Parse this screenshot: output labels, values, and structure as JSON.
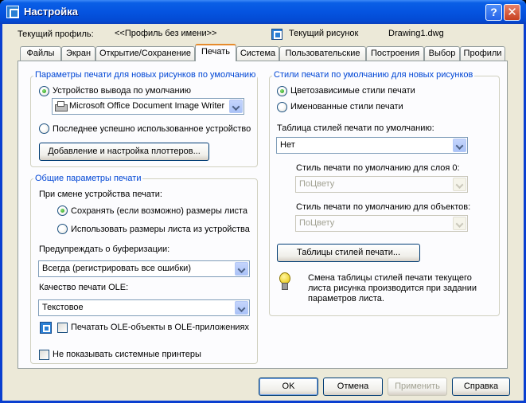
{
  "window": {
    "title": "Настройка",
    "help_glyph": "?",
    "close_glyph": "✕"
  },
  "header": {
    "profile_label": "Текущий профиль:",
    "profile_value": "<<Профиль без имени>>",
    "drawing_label": "Текущий рисунок",
    "drawing_value": "Drawing1.dwg"
  },
  "tabs": [
    {
      "label": "Файлы"
    },
    {
      "label": "Экран"
    },
    {
      "label": "Открытие/Сохранение"
    },
    {
      "label": "Печать",
      "active": true
    },
    {
      "label": "Система"
    },
    {
      "label": "Пользовательские"
    },
    {
      "label": "Построения"
    },
    {
      "label": "Выбор"
    },
    {
      "label": "Профили"
    }
  ],
  "new_drawings": {
    "title": "Параметры печати для новых рисунков по умолчанию",
    "default_device_label": "Устройство вывода по умолчанию",
    "device_value": "Microsoft Office Document Image Writer",
    "last_used_label": "Последнее успешно использованное устройство",
    "add_plotter_button": "Добавление и настройка плоттеров..."
  },
  "general": {
    "title": "Общие параметры печати",
    "on_device_change_label": "При смене устройства печати:",
    "keep_size_label": "Сохранять (если возможно) размеры листа",
    "use_device_size_label": "Использовать размеры листа из устройства",
    "spool_label": "Предупреждать о буферизации:",
    "spool_value": "Всегда (регистрировать все ошибки)",
    "ole_quality_label": "Качество печати OLE:",
    "ole_quality_value": "Текстовое",
    "ole_apps_label": "Печатать OLE-объекты в OLE-приложениях",
    "hide_system_printers_label": "Не показывать системные принтеры"
  },
  "styles": {
    "title": "Стили печати по умолчанию для новых рисунков",
    "color_dependent_label": "Цветозависимые стили печати",
    "named_label": "Именованные стили печати",
    "default_table_label": "Таблица стилей печати по умолчанию:",
    "default_table_value": "Нет",
    "layer0_label": "Стиль печати по умолчанию для слоя 0:",
    "layer0_value": "ПоЦвету",
    "objects_label": "Стиль печати по умолчанию для объектов:",
    "objects_value": "ПоЦвету",
    "tables_button": "Таблицы стилей печати...",
    "hint": "Смена таблицы стилей печати текущего листа рисунка производится при задании параметров листа."
  },
  "footer": {
    "ok": "OK",
    "cancel": "Отмена",
    "apply": "Применить",
    "help": "Справка"
  }
}
